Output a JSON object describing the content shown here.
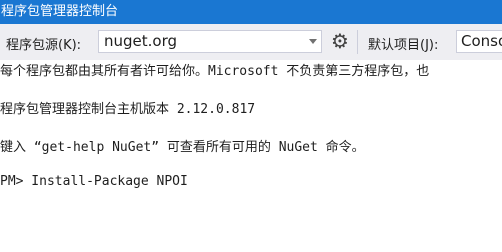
{
  "window": {
    "title": "程序包管理器控制台"
  },
  "toolbar": {
    "source_label": "程序包源(K):",
    "source_value": "nuget.org",
    "default_project_label": "默认项目(J):",
    "default_project_value": "Console"
  },
  "console": {
    "lines": [
      "每个程序包都由其所有者许可给你。Microsoft 不负责第三方程序包，也",
      "",
      "程序包管理器控制台主机版本 2.12.0.817",
      "",
      "键入 “get-help NuGet” 可查看所有可用的 NuGet 命令。",
      "",
      "PM> Install-Package NPOI"
    ]
  },
  "icons": {
    "settings": "gear-icon",
    "dropdown": "chevron-down-icon"
  }
}
